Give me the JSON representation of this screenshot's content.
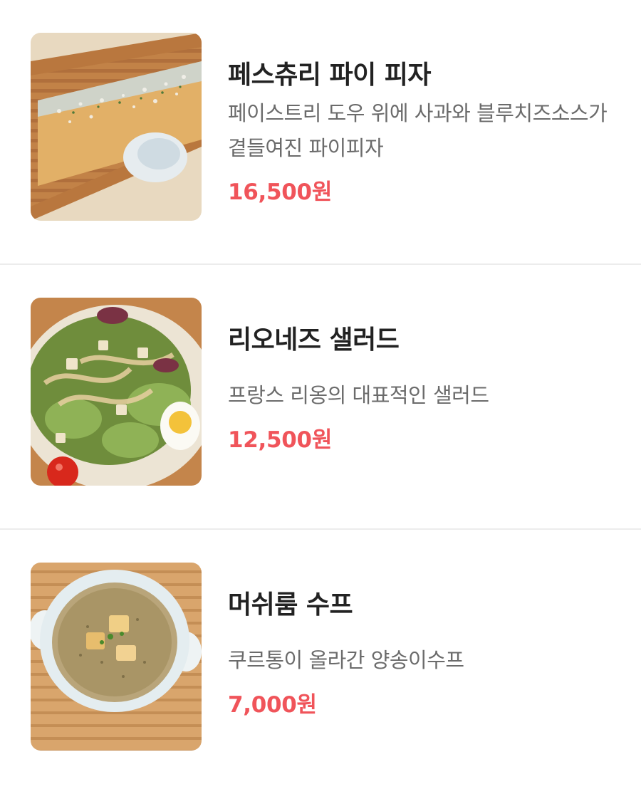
{
  "menu": {
    "items": [
      {
        "name": "페스츄리 파이 피자",
        "description": "페이스트리 도우 위에 사과와 블루치즈소스가 곁들여진 파이피자",
        "price": "16,500원",
        "image": "pastry-pie-pizza-photo"
      },
      {
        "name": "리오네즈 샐러드",
        "description": "프랑스 리옹의 대표적인 샐러드",
        "price": "12,500원",
        "image": "lyonnaise-salad-photo"
      },
      {
        "name": "머쉬룸 수프",
        "description": "쿠르통이 올라간 양송이수프",
        "price": "7,000원",
        "image": "mushroom-soup-photo"
      }
    ]
  },
  "colors": {
    "price": "#f0545a",
    "name": "#222222",
    "description": "#6b6b6b",
    "divider": "#ececec"
  }
}
